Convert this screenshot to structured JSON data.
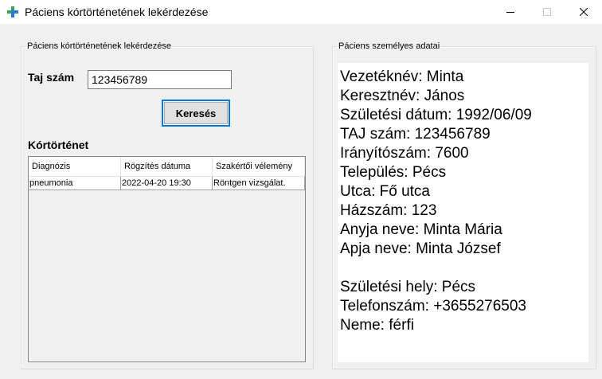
{
  "window": {
    "title": "Páciens kórtörténetének lekérdezése"
  },
  "left_group": {
    "legend": "Páciens kórtörténetének lekérdezése",
    "taj_label": "Taj szám",
    "taj_value": "123456789",
    "search_button": "Keresés",
    "history_label": "Kórtörténet",
    "table": {
      "columns": [
        "Diagnózis",
        "Rögzítés dátuma",
        "Szakértői vélemény"
      ],
      "rows": [
        [
          "pneumonia",
          "2022-04-20 19:30",
          "Röntgen vizsgálat."
        ]
      ]
    }
  },
  "right_group": {
    "legend": "Páciens személyes adatai",
    "lines": [
      "Vezetéknév: Minta",
      "Keresztnév: János",
      "Születési dátum: 1992/06/09",
      "TAJ szám: 123456789",
      "Irányítószám: 7600",
      "Település: Pécs",
      "Utca: Fő utca",
      "Házszám: 123",
      "Anyja neve: Minta Mária",
      "Apja neve: Minta József",
      "",
      "Születési hely: Pécs",
      "Telefonszám: +3655276503",
      "Neme: férfi"
    ]
  },
  "icons": {
    "app": "medical-cross-icon",
    "minimize": "minimize-icon",
    "maximize": "maximize-icon",
    "close": "close-icon"
  },
  "colors": {
    "app_icon_green": "#2fa84f",
    "app_icon_blue": "#2b7bd8",
    "focus_blue": "#0078d7"
  }
}
